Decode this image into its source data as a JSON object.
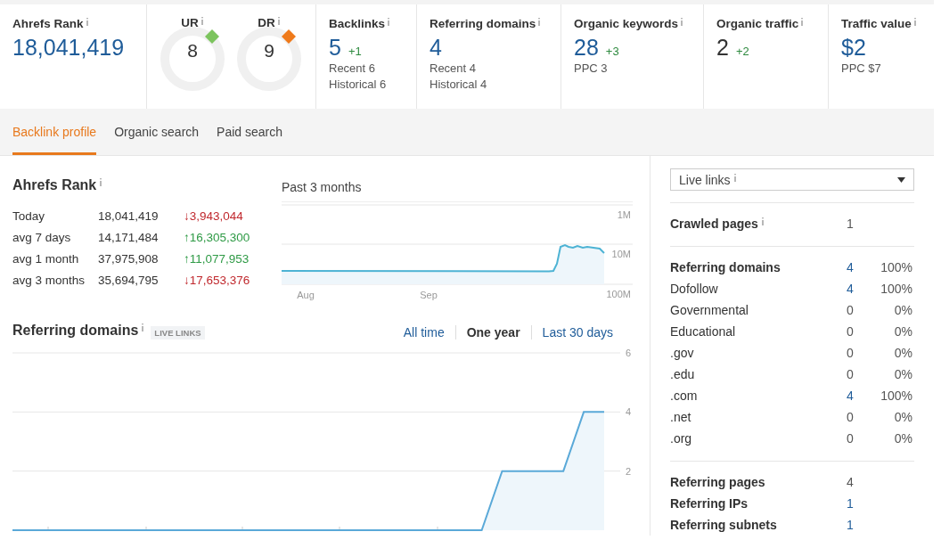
{
  "metrics": [
    {
      "kind": "rank",
      "title": "Ahrefs Rank",
      "info": true,
      "value": "18,041,419",
      "link": true
    },
    {
      "kind": "gauges",
      "gauges": [
        {
          "label": "UR",
          "info": true,
          "value": "8",
          "color": "#7cc45e"
        },
        {
          "label": "DR",
          "info": true,
          "value": "9",
          "color": "#ef7a1a"
        }
      ]
    },
    {
      "kind": "stat",
      "title": "Backlinks",
      "info": true,
      "value": "5",
      "link": true,
      "delta": "+1",
      "lines": [
        "Recent 6",
        "Historical 6"
      ]
    },
    {
      "kind": "stat",
      "title": "Referring domains",
      "info": true,
      "value": "4",
      "link": true,
      "lines": [
        "Recent 4",
        "Historical 4"
      ]
    },
    {
      "kind": "stat",
      "title": "Organic keywords",
      "info": true,
      "value": "28",
      "link": true,
      "delta": "+3",
      "lines": [
        "PPC 3"
      ]
    },
    {
      "kind": "stat",
      "title": "Organic traffic",
      "info": true,
      "value": "2",
      "link": false,
      "delta": "+2"
    },
    {
      "kind": "stat",
      "title": "Traffic value",
      "info": true,
      "value": "$2",
      "link": true,
      "lines": [
        "PPC $7"
      ]
    }
  ],
  "tabs": [
    {
      "label": "Backlink profile",
      "selected": true
    },
    {
      "label": "Organic search",
      "selected": false
    },
    {
      "label": "Paid search",
      "selected": false
    }
  ],
  "rank_panel": {
    "title": "Ahrefs Rank",
    "info": true,
    "rows": [
      {
        "label": "Today",
        "value": "18,041,419",
        "change": "↓3,943,044",
        "color": "#c0282d"
      },
      {
        "label": "avg 7 days",
        "value": "14,171,484",
        "change": "↑16,305,300",
        "color": "#2e9a45"
      },
      {
        "label": "avg 1 month",
        "value": "37,975,908",
        "change": "↑11,077,953",
        "color": "#2e9a45"
      },
      {
        "label": "avg 3 months",
        "value": "35,694,795",
        "change": "↓17,653,376",
        "color": "#c0282d"
      }
    ],
    "chart_title": "Past 3 months",
    "y_labels": [
      "1M",
      "10M",
      "100M"
    ],
    "x_labels": [
      "Aug",
      "Sep"
    ]
  },
  "domains_panel": {
    "title": "Referring domains",
    "info": true,
    "badge": "LIVE LINKS",
    "ranges": [
      {
        "label": "All time",
        "selected": false
      },
      {
        "label": "One year",
        "selected": true
      },
      {
        "label": "Last 30 days",
        "selected": false
      }
    ],
    "chart_data": {
      "type": "area",
      "categories": [
        null,
        null,
        null,
        null,
        null,
        null,
        null,
        null,
        null,
        null,
        null,
        null,
        null,
        null,
        null,
        null,
        null,
        null,
        null,
        null,
        null,
        null,
        null,
        null,
        null,
        null,
        null,
        null,
        null,
        null
      ],
      "series": [
        {
          "color": "#5aa9d8",
          "values": [
            0,
            0,
            0,
            0,
            0,
            0,
            0,
            0,
            0,
            0,
            0,
            0,
            0,
            0,
            0,
            0,
            0,
            0,
            0,
            0,
            0,
            0,
            0,
            0,
            2,
            2,
            2,
            2,
            4,
            4
          ]
        }
      ],
      "ylim": [
        0,
        6
      ],
      "yticks": [
        2,
        4,
        6
      ]
    }
  },
  "side": {
    "dropdown": {
      "value": "Live links",
      "info": true
    },
    "sections": [
      {
        "rows": [
          {
            "label": "Crawled pages",
            "bold": true,
            "info": true,
            "value": "1",
            "link": false
          }
        ]
      },
      {
        "rows": [
          {
            "label": "Referring domains",
            "bold": true,
            "value": "4",
            "link": true,
            "percent": "100%"
          },
          {
            "label": "Dofollow",
            "bold": false,
            "value": "4",
            "link": true,
            "percent": "100%"
          },
          {
            "label": "Governmental",
            "bold": false,
            "value": "0",
            "link": false,
            "percent": "0%"
          },
          {
            "label": "Educational",
            "bold": false,
            "value": "0",
            "link": false,
            "percent": "0%"
          },
          {
            "label": ".gov",
            "bold": false,
            "value": "0",
            "link": false,
            "percent": "0%"
          },
          {
            "label": ".edu",
            "bold": false,
            "value": "0",
            "link": false,
            "percent": "0%"
          },
          {
            "label": ".com",
            "bold": false,
            "value": "4",
            "link": true,
            "percent": "100%"
          },
          {
            "label": ".net",
            "bold": false,
            "value": "0",
            "link": false,
            "percent": "0%"
          },
          {
            "label": ".org",
            "bold": false,
            "value": "0",
            "link": false,
            "percent": "0%"
          }
        ]
      },
      {
        "rows": [
          {
            "label": "Referring pages",
            "bold": true,
            "value": "4",
            "link": false
          },
          {
            "label": "Referring IPs",
            "bold": true,
            "value": "1",
            "link": true
          },
          {
            "label": "Referring subnets",
            "bold": true,
            "value": "1",
            "link": true
          }
        ]
      }
    ]
  }
}
